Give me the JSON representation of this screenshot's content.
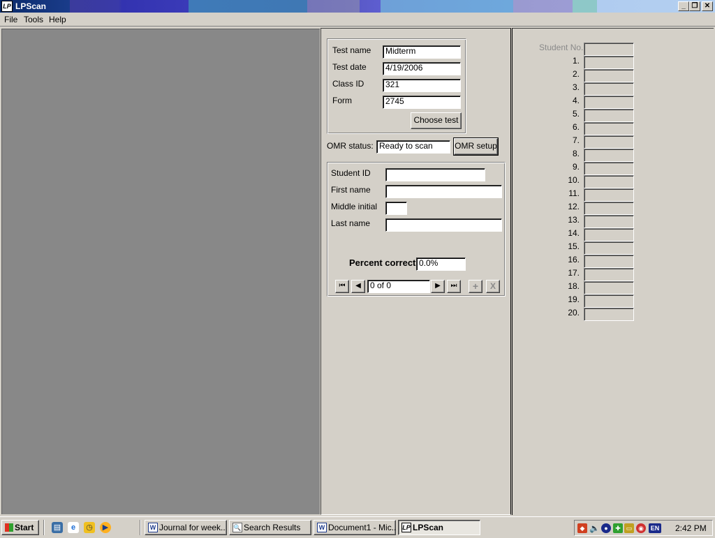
{
  "window": {
    "title": "LPScan",
    "icon_text": "LP"
  },
  "menu": [
    "File",
    "Tools",
    "Help"
  ],
  "test_info": {
    "test_name_label": "Test name",
    "test_name": "Midterm",
    "test_date_label": "Test date",
    "test_date": "4/19/2006",
    "class_id_label": "Class ID",
    "class_id": "321",
    "form_label": "Form",
    "form": "2745",
    "choose_test_label": "Choose test"
  },
  "omr": {
    "status_label": "OMR status:",
    "status_value": "Ready to scan",
    "setup_label": "OMR setup"
  },
  "student": {
    "student_id_label": "Student ID",
    "student_id": "",
    "first_name_label": "First name",
    "first_name": "",
    "middle_initial_label": "Middle initial",
    "middle_initial": "",
    "last_name_label": "Last name",
    "last_name": "",
    "percent_correct_label": "Percent correct",
    "percent_correct": "0.0%"
  },
  "navigator": {
    "position": "0 of 0",
    "first": "⏮",
    "prev": "◀",
    "next": "▶",
    "last": "⏭",
    "add": "+",
    "delete": "X"
  },
  "answers": {
    "header_label": "Student No.",
    "items": [
      "1.",
      "2.",
      "3.",
      "4.",
      "5.",
      "6.",
      "7.",
      "8.",
      "9.",
      "10.",
      "11.",
      "12.",
      "13.",
      "14.",
      "15.",
      "16.",
      "17.",
      "18.",
      "19.",
      "20."
    ]
  },
  "taskbar": {
    "start_label": "Start",
    "tasks": [
      {
        "label": "Journal for week...",
        "icon": "W"
      },
      {
        "label": "Search Results",
        "icon": "🔍"
      },
      {
        "label": "Document1 - Mic...",
        "icon": "W"
      },
      {
        "label": "LPScan",
        "icon": "LP"
      }
    ],
    "tray_lang": "EN",
    "clock": "2:42 PM"
  },
  "colors": {
    "accent": "#0a246a",
    "panel": "#d4d0c8",
    "workspace": "#888888"
  }
}
